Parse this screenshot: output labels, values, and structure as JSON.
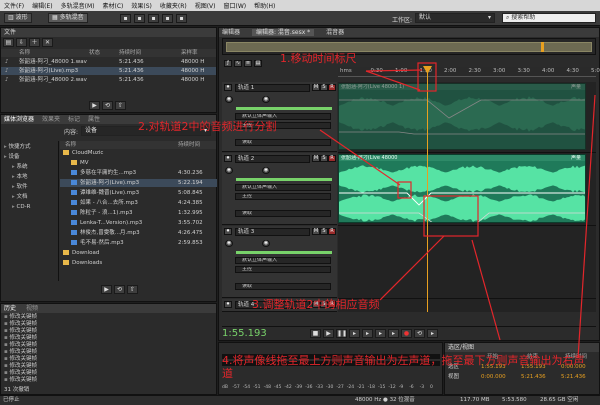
{
  "menu": [
    "文件(F)",
    "编辑(E)",
    "多轨混音(M)",
    "素材(C)",
    "效果(S)",
    "收藏夹(R)",
    "视图(V)",
    "窗口(W)",
    "帮助(H)"
  ],
  "toolbar": {
    "waveform": "波形",
    "multitrack": "多轨混音",
    "workspace_label": "工作区:",
    "workspace_value": "默认",
    "search_placeholder": "搜索帮助"
  },
  "files_panel": {
    "title": "文件",
    "col_name": "名称",
    "col_status": "状态",
    "col_duration": "持续时间",
    "col_samplerate": "采样率",
    "rows": [
      {
        "name": "张韶涵-阿刁_48000 1.wav",
        "duration": "5:21.436",
        "rate": "48000 H"
      },
      {
        "name": "张韶涵-阿刁(Live).mp3",
        "duration": "5:21.436",
        "rate": "48000 H"
      },
      {
        "name": "张韶涵-阿刁_48000 2.wav",
        "duration": "5:21.436",
        "rate": "48000 H"
      }
    ]
  },
  "browser_panel": {
    "tabs": [
      "媒体浏览器",
      "效果夹",
      "标记",
      "属性"
    ],
    "content_label": "内容:",
    "content_value": "设备",
    "col_name": "名称",
    "col_duration": "持续时间",
    "tree": [
      {
        "label": "快捷方式",
        "indent": 0
      },
      {
        "label": "设备",
        "indent": 0
      },
      {
        "label": "系统",
        "indent": 1
      },
      {
        "label": "本地",
        "indent": 1
      },
      {
        "label": "软件",
        "indent": 1
      },
      {
        "label": "文档",
        "indent": 1
      },
      {
        "label": "CD-R",
        "indent": 1
      }
    ],
    "files": [
      {
        "name": "CloudMuzic",
        "duration": "",
        "type": "folder",
        "indent": 0
      },
      {
        "name": "MV",
        "duration": "",
        "type": "folder",
        "indent": 1
      },
      {
        "name": "多慈在平庸的生...mp3",
        "duration": "4:30.236",
        "type": "file",
        "indent": 1
      },
      {
        "name": "张韶涵-阿刁(Live).mp3",
        "duration": "5:22.194",
        "type": "file",
        "indent": 1
      },
      {
        "name": "谭维维-魏晋(Live).mp3",
        "duration": "5:08.845",
        "type": "file",
        "indent": 1
      },
      {
        "name": "如果 - 八合...去所.mp3",
        "duration": "4:24.385",
        "type": "file",
        "indent": 1
      },
      {
        "name": "陈粒子 - 浪...1).mp3",
        "duration": "1:32.995",
        "type": "file",
        "indent": 1
      },
      {
        "name": "Lenka-T...Version).mp3",
        "duration": "3:55.702",
        "type": "file",
        "indent": 1
      },
      {
        "name": "林俊杰,曾雯敬...月.mp3",
        "duration": "4:26.475",
        "type": "file",
        "indent": 1
      },
      {
        "name": "毛不易-然后.mp3",
        "duration": "2:59.853",
        "type": "file",
        "indent": 1
      },
      {
        "name": "Download",
        "duration": "",
        "type": "folder",
        "indent": 0
      },
      {
        "name": "Downloads",
        "duration": "",
        "type": "folder",
        "indent": 0
      }
    ]
  },
  "history_panel": {
    "tabs": [
      "历史",
      "视频"
    ],
    "items": [
      "修改关键帧",
      "修改关键帧",
      "修改关键帧",
      "修改关键帧",
      "修改关键帧",
      "修改关键帧",
      "修改关键帧",
      "修改关键帧",
      "修改关键帧",
      "修改关键帧"
    ],
    "count": "31 次撤销"
  },
  "editor": {
    "tab_editor": "编辑器",
    "tab_session": "编辑器: 混音.sesx *",
    "tab_mixer": "混音器",
    "ruler": [
      "hms",
      "0:30",
      "1:00",
      "1:30",
      "2:00",
      "2:30",
      "3:00",
      "3:30",
      "4:00",
      "4:30",
      "5:00"
    ],
    "tracks": [
      {
        "name": "轨道 1",
        "input": "默认立体声输入",
        "output": "主控",
        "read": "读取",
        "clip": "张韶涵-阿刁(Live 48000 1)",
        "clip_right": "声量"
      },
      {
        "name": "轨道 2",
        "input": "默认立体声输入",
        "output": "主控",
        "read": "读取",
        "clip": "张韶涵-阿刁(Live 48000",
        "clip_right": "声量"
      },
      {
        "name": "轨道 3",
        "input": "默认立体声输入",
        "output": "主控",
        "read": "读取",
        "clip": "",
        "clip_right": ""
      },
      {
        "name": "轨道 4",
        "input": "",
        "output": "",
        "read": "",
        "clip": "",
        "clip_right": ""
      }
    ],
    "time_display": "1:55.193"
  },
  "selection": {
    "title": "选区/视图",
    "col_start": "开始",
    "col_end": "结束",
    "col_duration": "持续时间",
    "sel_label": "选区",
    "sel_start": "1:55.193",
    "sel_end": "1:55.193",
    "sel_dur": "0:00.000",
    "view_label": "视图",
    "view_start": "0:00.000",
    "view_end": "5:21.436",
    "view_dur": "5:21.436"
  },
  "level_ticks": [
    "dB",
    "-57",
    "-54",
    "-51",
    "-48",
    "-45",
    "-42",
    "-39",
    "-36",
    "-33",
    "-30",
    "-27",
    "-24",
    "-21",
    "-18",
    "-15",
    "-12",
    "-9",
    "-6",
    "-3",
    "0"
  ],
  "status": {
    "left": "已停止",
    "rate": "48000 Hz ● 32 位混音",
    "size": "117.70 MB",
    "duration": "5:53.580",
    "free": "28.65 GB 空闲"
  },
  "annotations": {
    "a1": "1.移动时间标尺",
    "a2": "2.对轨道2中的音频进行分割",
    "a3": "3.调整轨道2中的相应音频",
    "a4": "4.将声像线拖至最上方则声音输出为左声道，拖至最下方则声音输出为右声道"
  },
  "colors": {
    "clip": "#1f7a5a",
    "accent": "#e3262b",
    "playhead": "#e8a020"
  }
}
